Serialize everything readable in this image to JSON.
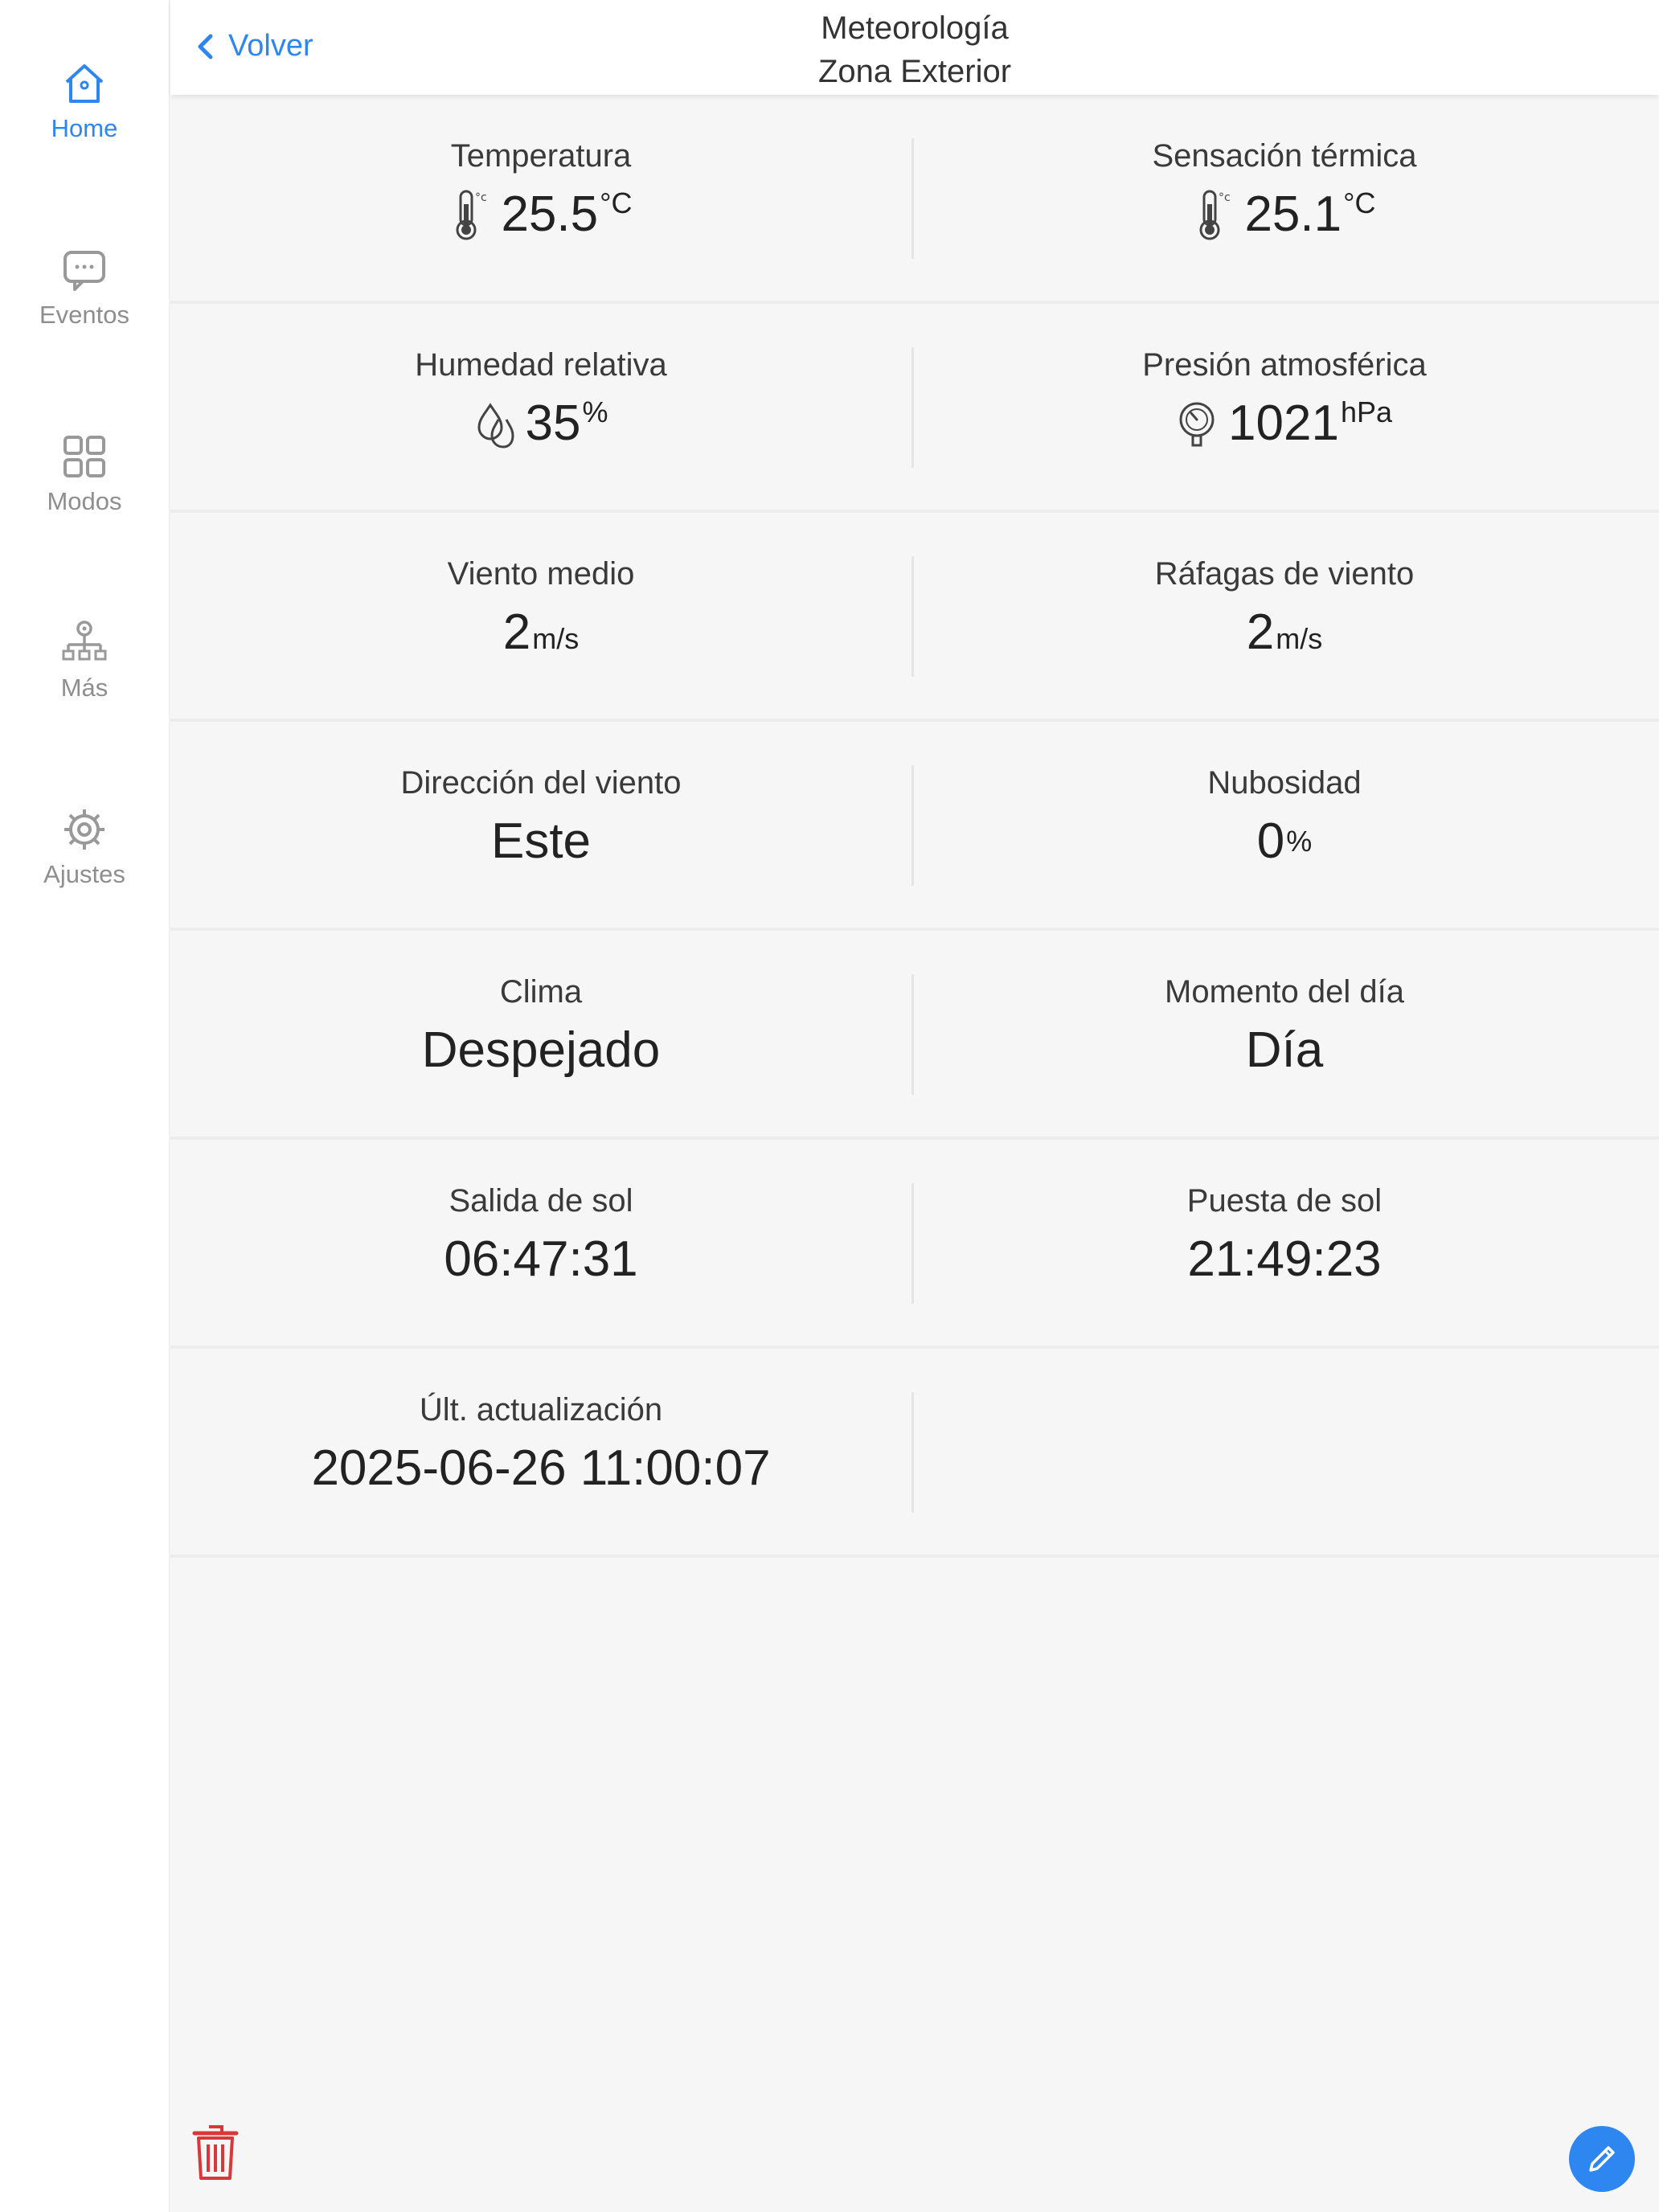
{
  "nav": {
    "items": [
      {
        "label": "Home",
        "icon": "home-icon",
        "active": true
      },
      {
        "label": "Eventos",
        "icon": "chat-icon"
      },
      {
        "label": "Modos",
        "icon": "grid-icon"
      },
      {
        "label": "Más",
        "icon": "network-icon"
      },
      {
        "label": "Ajustes",
        "icon": "gear-icon"
      }
    ]
  },
  "header": {
    "back_label": "Volver",
    "title_line1": "Meteorología",
    "title_line2": "Zona Exterior"
  },
  "measurements": [
    {
      "label": "Temperatura",
      "value": "25.5",
      "unit": "°C",
      "icon": "thermometer-icon"
    },
    {
      "label": "Sensación térmica",
      "value": "25.1",
      "unit": "°C",
      "icon": "thermometer-icon"
    },
    {
      "label": "Humedad relativa",
      "value": "35",
      "unit": "%",
      "icon": "humidity-icon"
    },
    {
      "label": "Presión atmosférica",
      "value": "1021",
      "unit": "hPa",
      "icon": "pressure-gauge-icon"
    },
    {
      "label": "Viento medio",
      "value": "2",
      "unit": "m/s"
    },
    {
      "label": "Ráfagas de viento",
      "value": "2",
      "unit": "m/s"
    },
    {
      "label": "Dirección del viento",
      "value": "Este",
      "unit": ""
    },
    {
      "label": "Nubosidad",
      "value": "0",
      "unit": "%"
    },
    {
      "label": "Clima",
      "value": "Despejado",
      "unit": ""
    },
    {
      "label": "Momento del día",
      "value": "Día",
      "unit": ""
    },
    {
      "label": "Salida de sol",
      "value": "06:47:31",
      "unit": ""
    },
    {
      "label": "Puesta de sol",
      "value": "21:49:23",
      "unit": ""
    },
    {
      "label": "Últ. actualización",
      "value": "2025-06-26 11:00:07",
      "unit": ""
    }
  ],
  "colors": {
    "accent": "#2e86f0",
    "delete": "#d9383a",
    "background": "#f6f6f7"
  }
}
